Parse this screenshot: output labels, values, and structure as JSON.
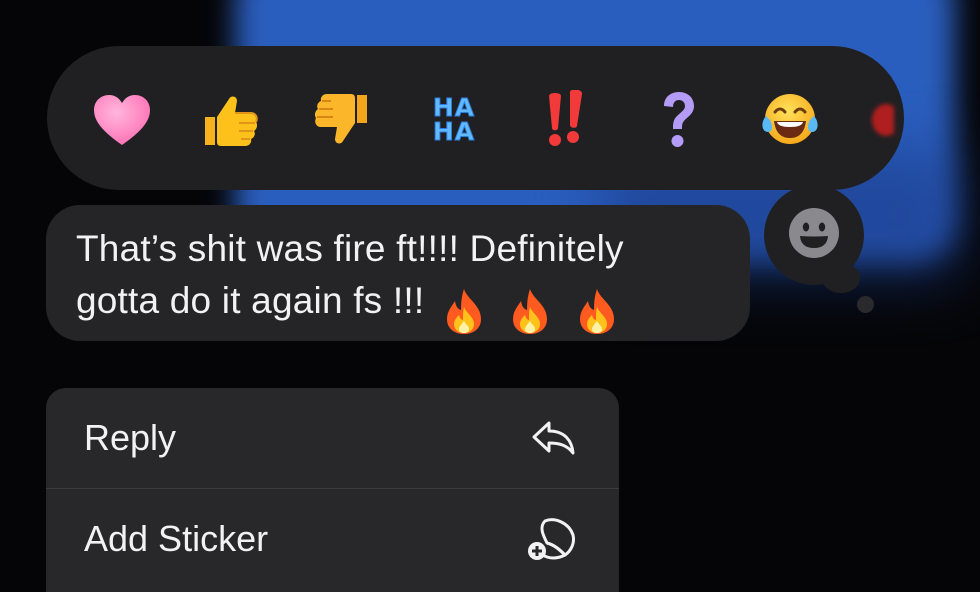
{
  "reactions": [
    {
      "name": "heart",
      "label": ""
    },
    {
      "name": "thumbs-up",
      "label": ""
    },
    {
      "name": "thumbs-down",
      "label": ""
    },
    {
      "name": "haha",
      "label": "HA\nHA"
    },
    {
      "name": "exclamation",
      "label": ""
    },
    {
      "name": "question",
      "label": ""
    },
    {
      "name": "tears-of-joy",
      "label": ""
    },
    {
      "name": "partially-visible",
      "label": ""
    }
  ],
  "haha": {
    "line1": "HA",
    "line2": "HA"
  },
  "add_reaction_icon": "smiley-face-icon",
  "message": {
    "line1": "That’s shit was fire ft!!!! Definitely",
    "line2": "gotta do it again fs !!!",
    "emojis": [
      "fire",
      "fire",
      "fire"
    ]
  },
  "menu": {
    "items": [
      {
        "label": "Reply",
        "icon": "reply-arrow-icon"
      },
      {
        "label": "Add Sticker",
        "icon": "add-sticker-icon"
      }
    ]
  },
  "colors": {
    "background": "#050507",
    "backdrop_blue": "#2d63c8",
    "bubble": "#252527",
    "reaction_bar": "#202022",
    "menu": "#28282b",
    "text": "#f2f2f4"
  }
}
